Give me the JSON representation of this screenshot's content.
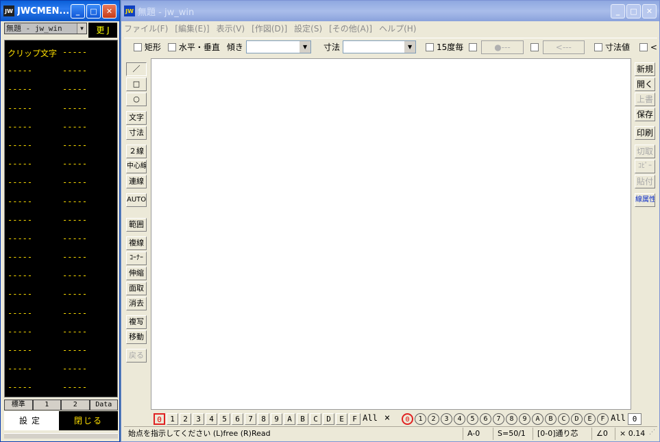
{
  "jwcmenu": {
    "title": "JWCMEN...",
    "icon_label": "JW",
    "file_select": "無題 - jw_win",
    "update_button": "更 J",
    "rows": [
      [
        "クリップ文字",
        "-----"
      ],
      [
        "-----",
        "-----"
      ],
      [
        "-----",
        "-----"
      ],
      [
        "-----",
        "-----"
      ],
      [
        "-----",
        "-----"
      ],
      [
        "-----",
        "-----"
      ],
      [
        "-----",
        "-----"
      ],
      [
        "-----",
        "-----"
      ],
      [
        "-----",
        "-----"
      ],
      [
        "-----",
        "-----"
      ],
      [
        "-----",
        "-----"
      ],
      [
        "-----",
        "-----"
      ],
      [
        "-----",
        "-----"
      ],
      [
        "-----",
        "-----"
      ],
      [
        "-----",
        "-----"
      ],
      [
        "-----",
        "-----"
      ],
      [
        "-----",
        "-----"
      ],
      [
        "-----",
        "-----"
      ],
      [
        "-----",
        "-----"
      ]
    ],
    "tabs": [
      "標準",
      "1",
      "2",
      "Data"
    ],
    "settings_button": "設定",
    "close_button": "閉じる"
  },
  "jwwin": {
    "title": "無題 - jw_win",
    "icon_label": "JW",
    "menu": [
      "ファイル(F)",
      "[編集(E)]",
      "表示(V)",
      "[作図(D)]",
      "設定(S)",
      "[その他(A)]",
      "ヘルプ(H)"
    ],
    "toolbar": {
      "rect": "矩形",
      "hv": "水平・垂直",
      "slope": "傾き",
      "dim": "寸法",
      "deg15": "15度毎",
      "dot_btn": "●---",
      "arrow_btn": "<---",
      "dimval": "寸法値",
      "last": "<"
    },
    "left_tools": [
      {
        "label": "／",
        "name": "line-tool"
      },
      {
        "label": "□",
        "name": "rectangle-tool"
      },
      {
        "label": "○",
        "name": "circle-tool"
      },
      {
        "label": "文字",
        "name": "text-tool"
      },
      {
        "label": "寸法",
        "name": "dimension-tool"
      },
      {
        "label": "２線",
        "name": "double-line-tool"
      },
      {
        "label": "中心線",
        "name": "center-line-tool"
      },
      {
        "label": "連線",
        "name": "continuous-line-tool"
      },
      {
        "label": "AUTO",
        "name": "auto-tool"
      },
      {
        "label": "範囲",
        "name": "range-tool"
      },
      {
        "label": "複線",
        "name": "parallel-line-tool"
      },
      {
        "label": "ｺｰﾅｰ",
        "name": "corner-tool"
      },
      {
        "label": "伸縮",
        "name": "extend-tool"
      },
      {
        "label": "面取",
        "name": "chamfer-tool"
      },
      {
        "label": "消去",
        "name": "erase-tool"
      },
      {
        "label": "複写",
        "name": "copy-tool"
      },
      {
        "label": "移動",
        "name": "move-tool"
      },
      {
        "label": "戻る",
        "name": "undo-tool"
      }
    ],
    "right_tools": [
      {
        "label": "新規",
        "name": "new-button"
      },
      {
        "label": "開く",
        "name": "open-button"
      },
      {
        "label": "上書",
        "name": "overwrite-button"
      },
      {
        "label": "保存",
        "name": "save-button"
      },
      {
        "label": "印刷",
        "name": "print-button"
      },
      {
        "label": "切取",
        "name": "cut-button"
      },
      {
        "label": "ｺﾋﾟｰ",
        "name": "copy-button"
      },
      {
        "label": "貼付",
        "name": "paste-button"
      },
      {
        "label": "線属性",
        "name": "line-attribute-button"
      }
    ],
    "layer_groups": [
      "0",
      "1",
      "2",
      "3",
      "4",
      "5",
      "6",
      "7",
      "8",
      "9",
      "A",
      "B",
      "C",
      "D",
      "E",
      "F"
    ],
    "layer_all": "All",
    "layer_x": "×",
    "layers": [
      "0",
      "1",
      "2",
      "3",
      "4",
      "5",
      "6",
      "7",
      "8",
      "9",
      "A",
      "B",
      "C",
      "D",
      "E",
      "F"
    ],
    "layer_all2": "All",
    "layer_current": "0",
    "status": {
      "message": "始点を指示してください (L)free (R)Read",
      "layer": "A-0",
      "scale": "S=50/1",
      "snap": "[0-0]通り芯",
      "angle": "∠0",
      "zoom": "× 0.14"
    }
  }
}
